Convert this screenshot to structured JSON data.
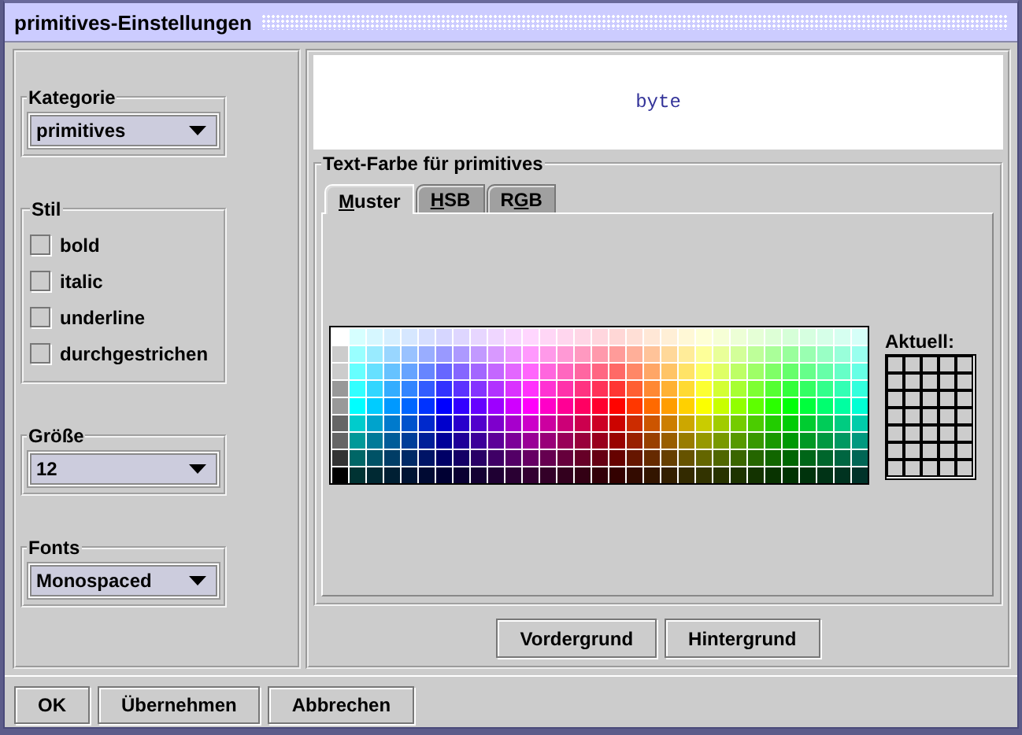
{
  "window": {
    "title": "primitives-Einstellungen"
  },
  "kategorie": {
    "label": "Kategorie",
    "value": "primitives"
  },
  "stil": {
    "label": "Stil",
    "options": [
      {
        "label": "bold",
        "checked": false
      },
      {
        "label": "italic",
        "checked": false
      },
      {
        "label": "underline",
        "checked": false
      },
      {
        "label": "durchgestrichen",
        "checked": false
      }
    ]
  },
  "groesse": {
    "label": "Größe",
    "value": "12"
  },
  "fonts": {
    "label": "Fonts",
    "value": "Monospaced"
  },
  "preview": {
    "text": "byte"
  },
  "color_group": {
    "title": "Text-Farbe für primitives",
    "tabs": [
      {
        "key": "M",
        "after": "uster",
        "selected": true
      },
      {
        "key": "H",
        "after": "SB",
        "selected": false
      },
      {
        "before": "R",
        "key": "G",
        "after": "B",
        "selected": false
      }
    ],
    "recent_label": "Aktuell:"
  },
  "color_buttons": [
    "Vordergrund",
    "Hintergrund"
  ],
  "dialog_buttons": [
    "OK",
    "Übernehmen",
    "Abbrechen"
  ]
}
